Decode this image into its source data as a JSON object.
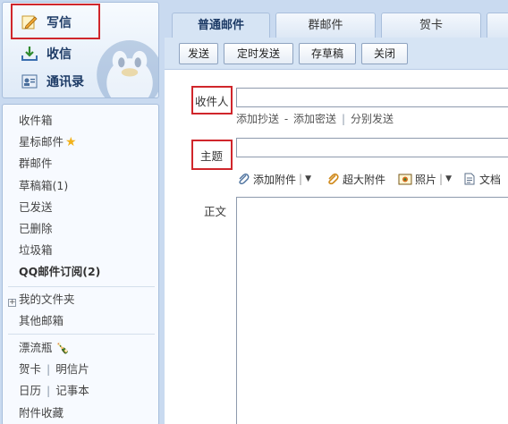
{
  "sidebar": {
    "compose_label": "写信",
    "inbox_label": "收信",
    "contacts_label": "通讯录",
    "folders": [
      "收件箱",
      "星标邮件",
      "群邮件",
      "草稿箱(1)",
      "已发送",
      "已删除",
      "垃圾箱"
    ],
    "subscription_label": "QQ邮件订阅(2)",
    "my_folders_label": "我的文件夹",
    "other_mailbox_label": "其他邮箱",
    "drift_bottle_label": "漂流瓶",
    "greeting_card_label": "贺卡",
    "postcard_label": "明信片",
    "calendar_label": "日历",
    "notepad_label": "记事本",
    "attachment_fav_label": "附件收藏"
  },
  "tabs": {
    "normal_mail": "普通邮件",
    "group_mail": "群邮件",
    "greeting_card": "贺卡",
    "more": ""
  },
  "toolbar": {
    "send": "发送",
    "scheduled_send": "定时发送",
    "save_draft": "存草稿",
    "close": "关闭"
  },
  "form": {
    "recipient_label": "收件人",
    "recipient_value": "",
    "add_cc": "添加抄送",
    "add_bcc": "添加密送",
    "separate_send": "分别发送",
    "subject_label": "主题",
    "subject_value": "",
    "add_attachment": "添加附件",
    "large_attachment": "超大附件",
    "photo": "照片",
    "document": "文档",
    "body_label": "正文",
    "body_value": ""
  },
  "colors": {
    "highlight": "#d0262b",
    "sidebar_bg": "#c9daf0",
    "star": "#f2b21b"
  }
}
